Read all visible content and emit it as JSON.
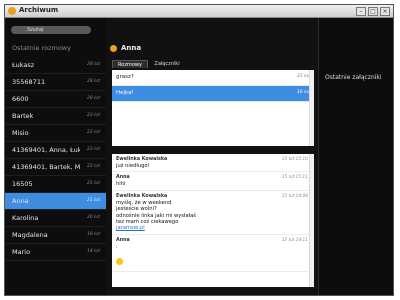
{
  "window": {
    "title": "Archiwum"
  },
  "search": {
    "placeholder": "Szukaj"
  },
  "sidebar": {
    "heading": "Ostatnie rozmowy",
    "contacts": [
      {
        "name": "Łukasz",
        "date": "28 lut"
      },
      {
        "name": "35568711",
        "date": "28 lut"
      },
      {
        "name": "6600",
        "date": "28 lut"
      },
      {
        "name": "Bartek",
        "date": "23 lut"
      },
      {
        "name": "Misio",
        "date": "23 lut"
      },
      {
        "name": "41369401, Anna, Łuk...",
        "date": "23 lut"
      },
      {
        "name": "41369401, Bartek, Mi...",
        "date": "23 lut"
      },
      {
        "name": "16505",
        "date": "21 lut"
      },
      {
        "name": "Anna",
        "date": "21 lut"
      },
      {
        "name": "Karolina",
        "date": "20 lut"
      },
      {
        "name": "Magdalena",
        "date": "18 lut"
      },
      {
        "name": "Mario",
        "date": "14 lut"
      }
    ]
  },
  "chat": {
    "name": "Anna",
    "tabs": [
      "Rozmowy",
      "Załączniki"
    ],
    "conversations": [
      {
        "text": "grasz?",
        "date": "21 lut"
      },
      {
        "text": "Hejka!",
        "date": "16 lut"
      }
    ],
    "messages": [
      {
        "author": "Ewelinka Kowalska",
        "time": "15 lut 15:10",
        "lines": [
          "już niedługo!"
        ]
      },
      {
        "author": "Anna",
        "time": "15 lut 15:11",
        "lines": [
          "hihi"
        ]
      },
      {
        "author": "Ewelinka Kowalska",
        "time": "15 lut 14:08",
        "lines": [
          "myślę, że w weekend",
          "jesteście wolni?",
          "odnośnie linka jaki mi wysłałaś",
          "tez mam coś ciekawego"
        ],
        "link": "jaramsie.pl"
      },
      {
        "author": "Anna",
        "time": "15 lut 14:11",
        "lines": [
          ":"
        ],
        "emoji": "smiley-icon"
      }
    ]
  },
  "right_panel": {
    "heading": "Ostatnie załączniki"
  },
  "colors": {
    "accent": "#3f8de0",
    "window_bg": "#111111"
  }
}
